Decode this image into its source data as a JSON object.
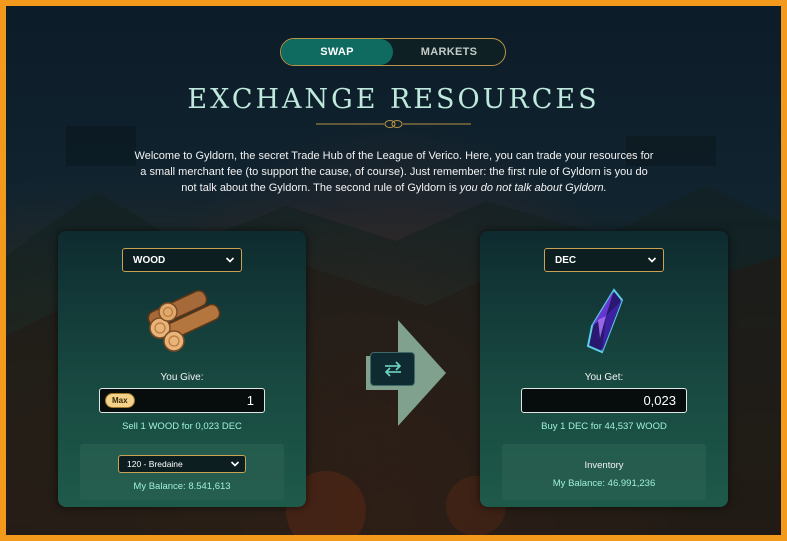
{
  "tabs": [
    {
      "label": "SWAP",
      "active": true
    },
    {
      "label": "MARKETS",
      "active": false
    }
  ],
  "title": "EXCHANGE RESOURCES",
  "intro": {
    "text": "Welcome to Gyldorn, the secret Trade Hub of the League of Verico. Here, you can trade your resources for a small merchant fee (to support the cause, of course). Just remember: the first rule of Gyldorn is you do not talk about the Gyldorn. The second rule of Gyldorn is ",
    "emphasis": "you do not talk about Gyldorn."
  },
  "give": {
    "resource": "WOOD",
    "label": "You Give:",
    "max_label": "Max",
    "amount": "1",
    "rate": "Sell 1 WOOD for 0,023 DEC",
    "land": "120 - Bredaine",
    "balance": "My Balance: 8.541,613",
    "icon": "wood-logs-icon"
  },
  "get": {
    "resource": "DEC",
    "label": "You Get:",
    "amount": "0,023",
    "rate": "Buy 1 DEC for 44,537 WOOD",
    "inventory_label": "Inventory",
    "balance": "My Balance: 46.991,236",
    "icon": "dec-crystal-icon"
  },
  "colors": {
    "frame": "#f39a1c",
    "accent": "#0f6b60",
    "gold": "#c9a255",
    "mint": "#9ff0d8"
  }
}
